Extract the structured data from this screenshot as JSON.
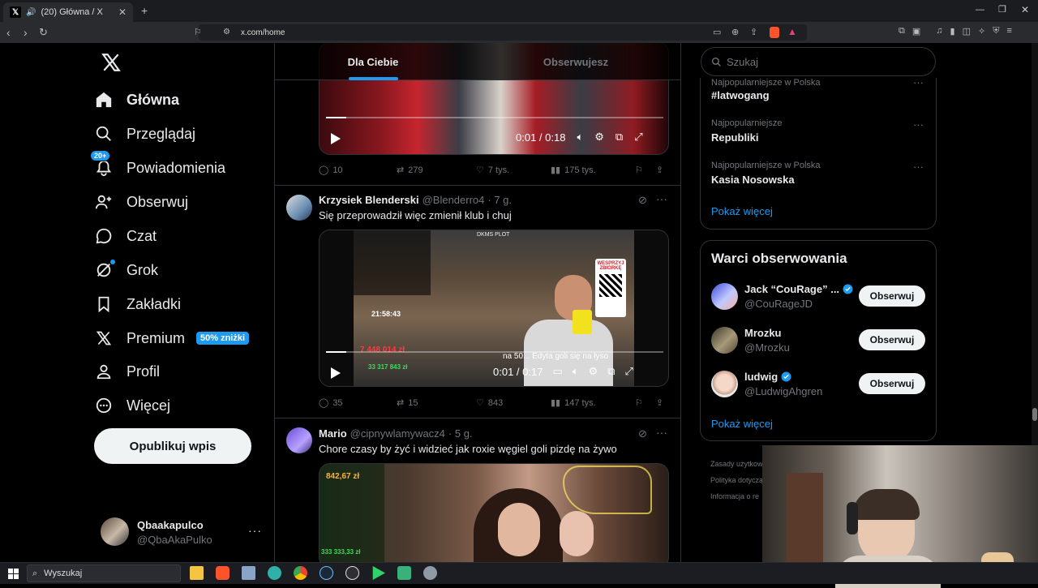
{
  "browser": {
    "tab_title": "(20) Główna / X",
    "url": "x.com/home"
  },
  "nav": {
    "items": [
      {
        "label": "Główna"
      },
      {
        "label": "Przeglądaj"
      },
      {
        "label": "Powiadomienia",
        "badge": "20+"
      },
      {
        "label": "Obserwuj"
      },
      {
        "label": "Czat"
      },
      {
        "label": "Grok"
      },
      {
        "label": "Zakładki"
      },
      {
        "label": "Premium",
        "badge": "50% zniżki"
      },
      {
        "label": "Profil"
      },
      {
        "label": "Więcej"
      }
    ],
    "post_button": "Opublikuj wpis",
    "account": {
      "name": "Qbaakapulco",
      "handle": "@QbaAkaPulko"
    }
  },
  "feed": {
    "tabs": [
      "Dla Ciebie",
      "Obserwujesz"
    ],
    "top_video": {
      "time": "0:01 / 0:18",
      "progress": 0.06
    },
    "top_actions": {
      "replies": "10",
      "reposts": "279",
      "likes": "7 tys.",
      "views": "175 tys."
    },
    "posts": [
      {
        "name": "Krzysiek Blenderski",
        "handle": "@Blenderro4",
        "time": "· 7 g.",
        "text": "Się przeprowadził więc zmienił klub i chuj",
        "video": {
          "time": "0:01 / 0:17",
          "progress": 0.06,
          "overlay_text": "na 50... Edyta goli się na łyso",
          "money1": "7 448 014 zł",
          "money2": "33 317 843 zł",
          "clock": "21:58:43",
          "sign": "WESPRZYJ ZBIÓRKĘ",
          "dkms": "DKMS PLOT"
        },
        "actions": {
          "replies": "35",
          "reposts": "15",
          "likes": "843",
          "views": "147 tys."
        }
      },
      {
        "name": "Mario",
        "handle": "@cipnywlamywacz4",
        "time": "· 5 g.",
        "text": "Chore czasy by żyć i widzieć jak roxie węgiel goli pizdę na żywo",
        "video": {
          "money1": "842,67 zł",
          "money2": "333 333,33 zł"
        }
      }
    ]
  },
  "sidebar": {
    "search_placeholder": "Szukaj",
    "trends": [
      {
        "context": "Najpopularniejsze w Polska",
        "title": "#latwogang"
      },
      {
        "context": "Najpopularniejsze",
        "title": "Republiki"
      },
      {
        "context": "Najpopularniejsze w Polska",
        "title": "Kasia Nosowska"
      }
    ],
    "show_more": "Pokaż więcej",
    "who_to_follow_title": "Warci obserwowania",
    "who_to_follow": [
      {
        "name": "Jack “CouRage” ...",
        "handle": "@CouRageJD",
        "verified": true,
        "button": "Obserwuj"
      },
      {
        "name": "Mrozku",
        "handle": "@Mrozku",
        "verified": false,
        "button": "Obserwuj"
      },
      {
        "name": "ludwig",
        "handle": "@LudwigAhgren",
        "verified": true,
        "button": "Obserwuj"
      }
    ],
    "show_more2": "Pokaż więcej",
    "footer": [
      "Zasady użytkowania",
      "Polityka dotycząca",
      "Informacja o re"
    ]
  },
  "taskbar": {
    "search": "Wyszukaj"
  },
  "colors": {
    "accent": "#1d9bf0",
    "bg": "#000000",
    "text": "#e7e9ea",
    "muted": "#71767b",
    "border": "#2f3336"
  }
}
